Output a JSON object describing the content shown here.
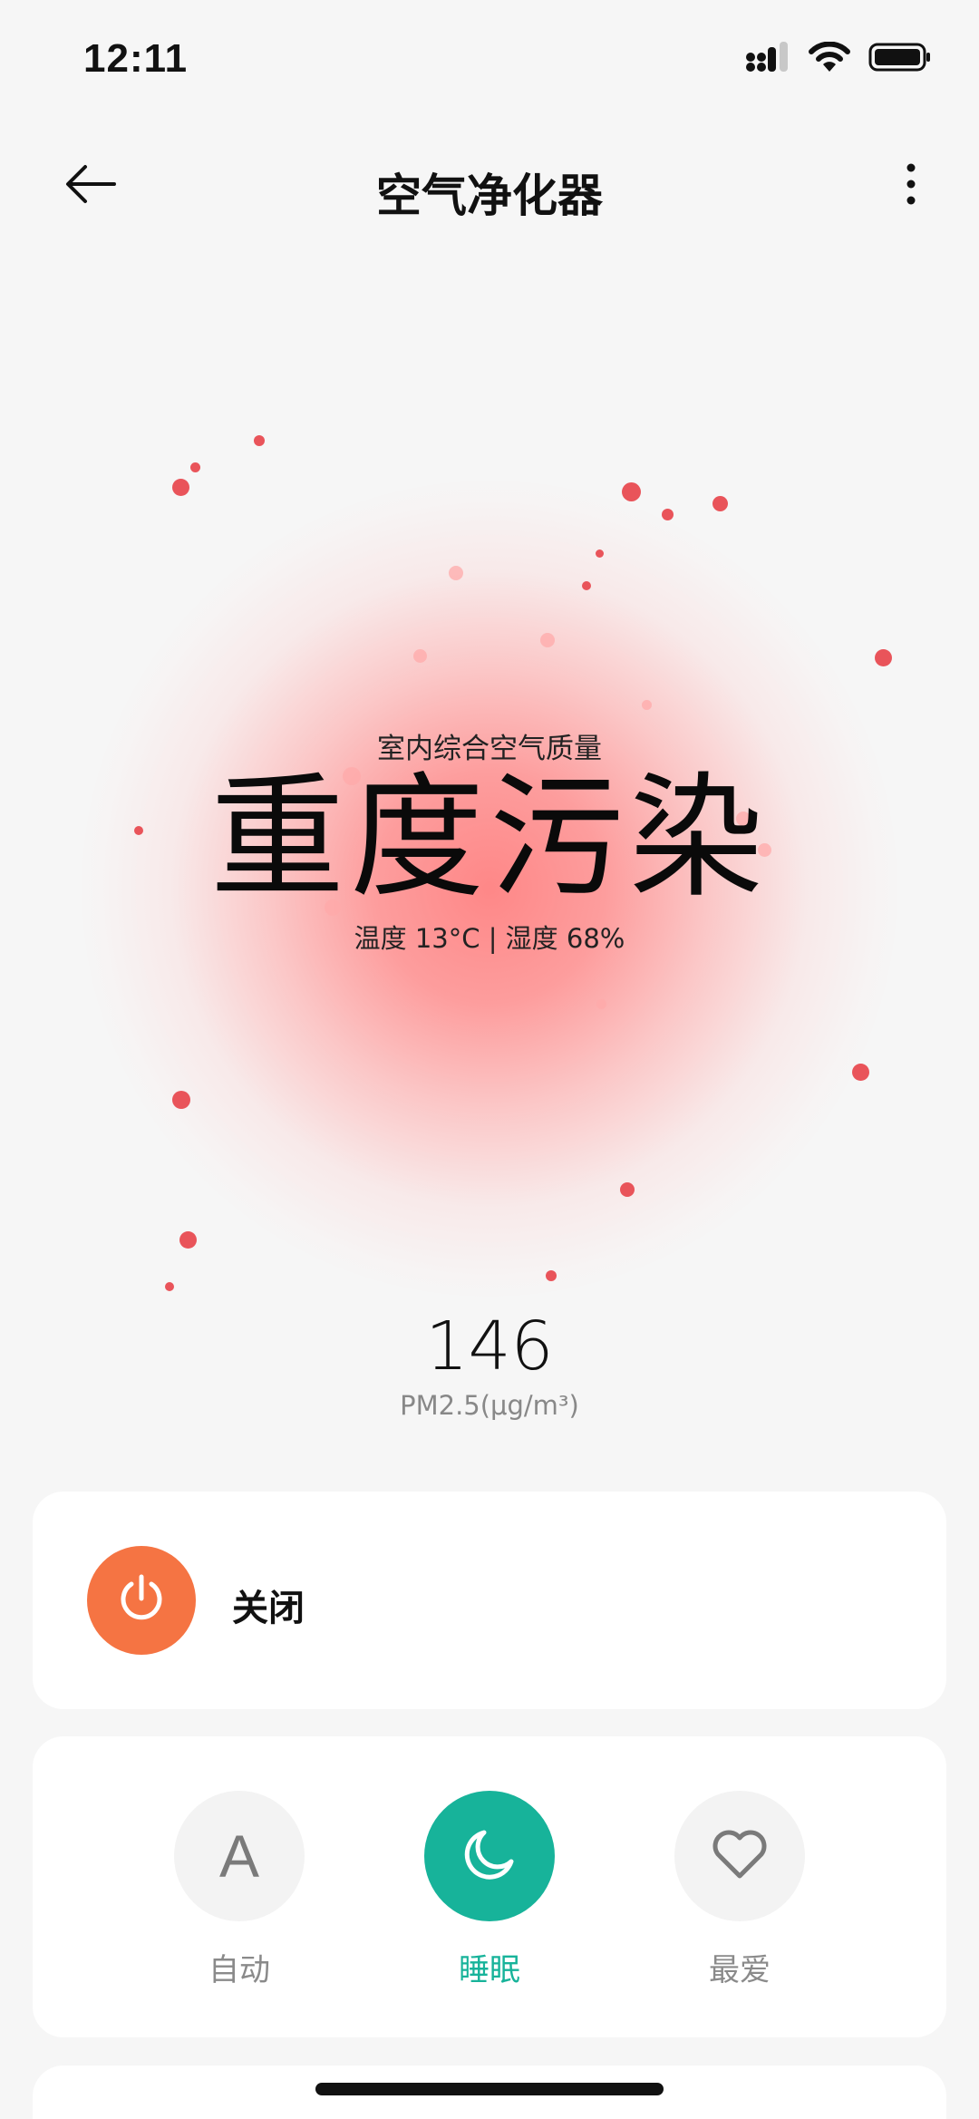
{
  "status_bar": {
    "time": "12:11"
  },
  "header": {
    "title": "空气净化器",
    "back_icon": "arrow-left-icon",
    "more_icon": "more-vertical-icon"
  },
  "air_quality": {
    "caption": "室内综合空气质量",
    "level": "重度污染",
    "environment": "温度 13°C | 湿度 68%",
    "pm25_value": "146",
    "pm25_unit": "PM2.5(μg/m³)",
    "accent_color": "#e9545a"
  },
  "power": {
    "label": "关闭",
    "icon": "power-icon",
    "color": "#f57443"
  },
  "modes": [
    {
      "label": "自动",
      "icon": "auto-letter-icon",
      "glyph": "A",
      "active": false
    },
    {
      "label": "睡眠",
      "icon": "moon-icon",
      "active": true
    },
    {
      "label": "最爱",
      "icon": "heart-icon",
      "active": false
    }
  ],
  "colors": {
    "active_mode": "#17b39a",
    "background": "#f6f6f6"
  }
}
